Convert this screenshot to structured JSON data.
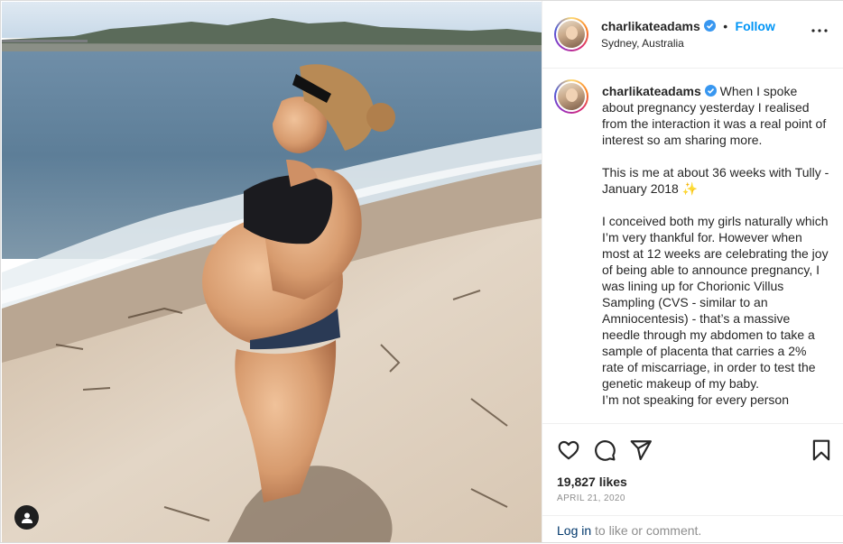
{
  "post": {
    "username": "charlikateadams",
    "location": "Sydney, Australia",
    "follow_label": "Follow",
    "separator": "•",
    "caption_paragraphs": [
      "When I spoke about pregnancy yesterday I realised from the interaction it was a real point of interest so am sharing more.",
      "This is me at about 36 weeks with Tully - January 2018 ✨",
      "I conceived both my girls naturally which I’m very thankful for. However when most at 12 weeks are celebrating the joy of being able to announce pregnancy, I was lining up for Chorionic Villus Sampling (CVS - similar to an Amniocentesis) - that’s a massive needle through my abdomen to take a sample of placenta that carries a 2% rate of miscarriage, in order to test the genetic makeup of my baby.\nI’m not speaking for every person"
    ],
    "likes": "19,827 likes",
    "date": "APRIL 21, 2020",
    "login_link": "Log in",
    "login_rest": " to like or comment."
  },
  "colors": {
    "accent": "#0095f6",
    "verified": "#3897f0",
    "muted": "#8e8e8e",
    "text": "#262626"
  },
  "icons": [
    "user-tag-icon",
    "verified-badge-icon",
    "more-options-icon",
    "like-heart-icon",
    "comment-icon",
    "share-icon",
    "save-bookmark-icon"
  ]
}
